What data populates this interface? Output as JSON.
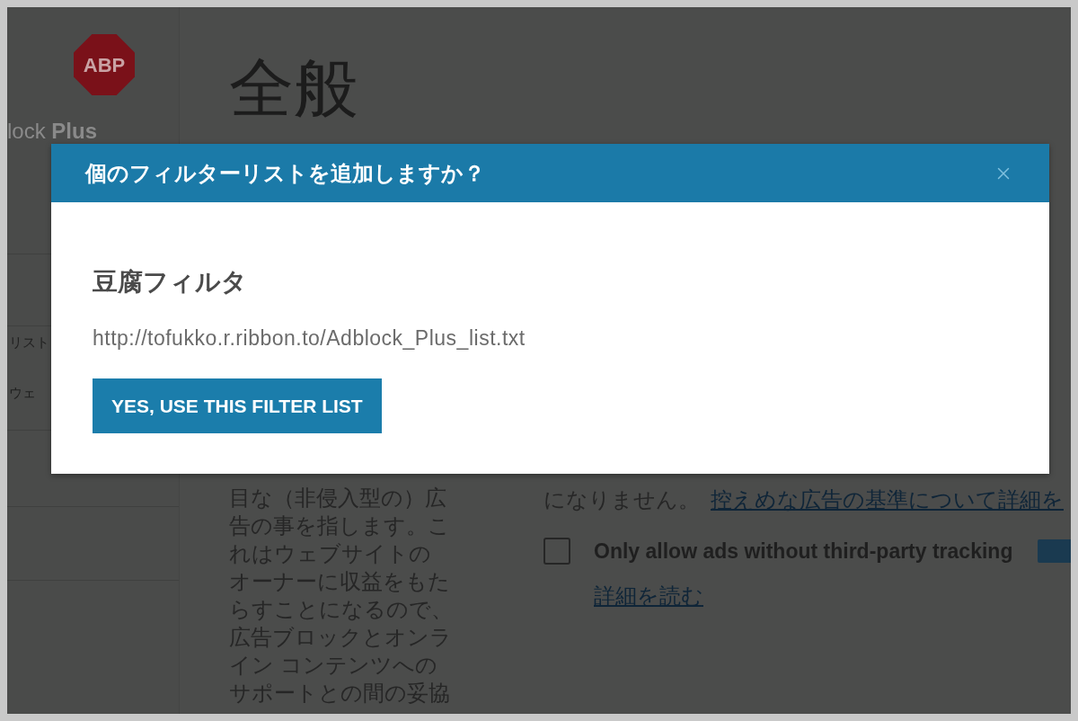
{
  "sidebar": {
    "logo": "ABP",
    "brand": "lock **Plus**",
    "items": [
      {
        "label": "リスト"
      },
      {
        "label": "ウェ"
      }
    ]
  },
  "main": {
    "heading": "全般",
    "description": "目な（非侵入型の）広告の事を指します。これはウェブサイトのオーナーに収益をもたらすことになるので、広告ブロックとオンライン コンテンツへのサポートとの間の妥協",
    "note": {
      "text": "になりません。",
      "link": "控えめな広告の基準について詳細を"
    },
    "option": {
      "label": "Only allow ads without third-party tracking",
      "checked": false,
      "link": "詳細を読む"
    }
  },
  "dialog": {
    "title": "個のフィルターリストを追加しますか？",
    "filter_name": "豆腐フィルタ",
    "url": "http://tofukko.r.ribbon.to/Adblock_Plus_list.txt",
    "button": "YES, USE THIS FILTER LIST"
  }
}
